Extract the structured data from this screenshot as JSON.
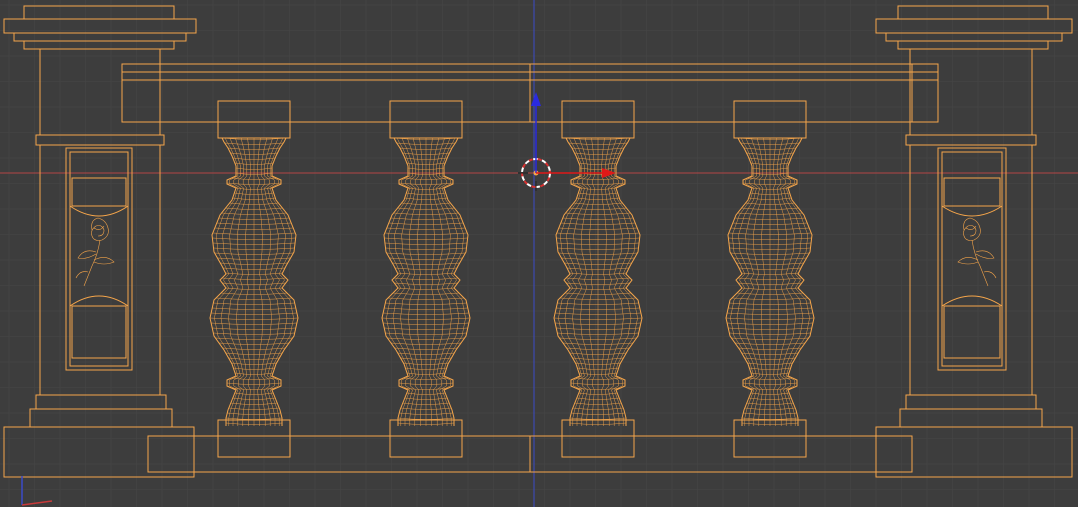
{
  "app": {
    "name": "3D Viewport"
  },
  "viewport": {
    "background_color": "#3d3d3d",
    "grid_color": "#454545",
    "wire_color": "#f5a54a",
    "x_axis_color": "#b34545",
    "z_axis_color": "#3b4bc8",
    "cursor": {
      "icon": "3d-cursor-icon"
    },
    "gizmo": {
      "icon": "transform-gizmo-icon",
      "x_arrow_color": "#e01818",
      "z_arrow_color": "#2a2ae0"
    },
    "axis_indicator": {
      "icon": "axis-indicator-icon"
    }
  },
  "model": {
    "name": "balustrade",
    "posts": [
      {
        "side": "left",
        "ornament": "rose-carving-icon"
      },
      {
        "side": "right",
        "ornament": "rose-carving-icon"
      }
    ],
    "baluster_count": 4
  }
}
